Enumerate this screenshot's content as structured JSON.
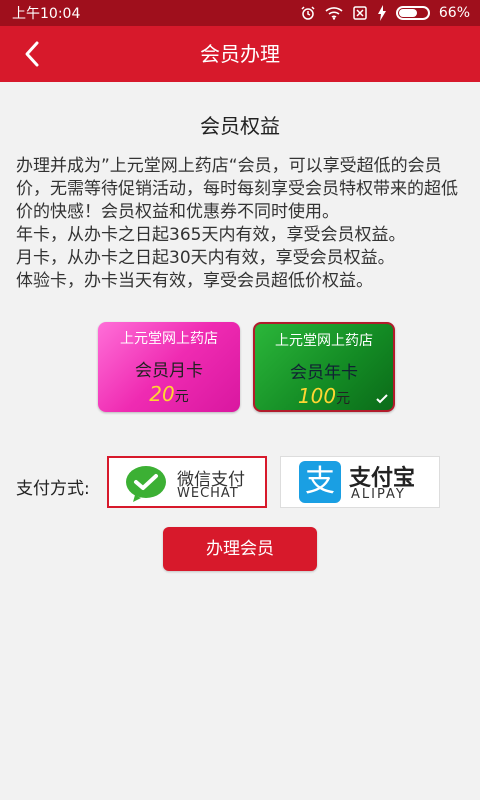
{
  "status": {
    "time": "上午10:04",
    "battery": "66%",
    "icons": [
      "alarm-icon",
      "wifi-icon",
      "no-sim-icon",
      "charging-icon",
      "battery-icon"
    ]
  },
  "nav": {
    "back_icon": "chevron-left-icon",
    "title": "会员办理"
  },
  "section_title": "会员权益",
  "description": [
    "办理并成为”上元堂网上药店“会员，可以享受超低的会员价，无需等待促销活动，每时每刻享受会员特权带来的超低价的快感！会员权益和优惠券不同时使用。",
    "年卡，从办卡之日起365天内有效，享受会员权益。",
    "月卡，从办卡之日起30天内有效，享受会员权益。",
    "体验卡，办卡当天有效，享受会员超低价权益。"
  ],
  "cards": [
    {
      "shop": "上元堂网上药店",
      "name": "会员月卡",
      "price": "20",
      "unit": "元",
      "selected": false
    },
    {
      "shop": "上元堂网上药店",
      "name": "会员年卡",
      "price": "100",
      "unit": "元",
      "selected": true
    }
  ],
  "payment": {
    "label": "支付方式:",
    "wechat": {
      "cn": "微信支付",
      "en": "WECHAT",
      "selected": true
    },
    "alipay": {
      "cn": "支付宝",
      "en": "ALIPAY",
      "icon_char": "支",
      "selected": false
    }
  },
  "submit_label": "办理会员",
  "colors": {
    "brand_red": "#d7192b",
    "status_bar": "#9f0f1c",
    "alipay_blue": "#1a9fe3",
    "wechat_green": "#3cb034"
  }
}
